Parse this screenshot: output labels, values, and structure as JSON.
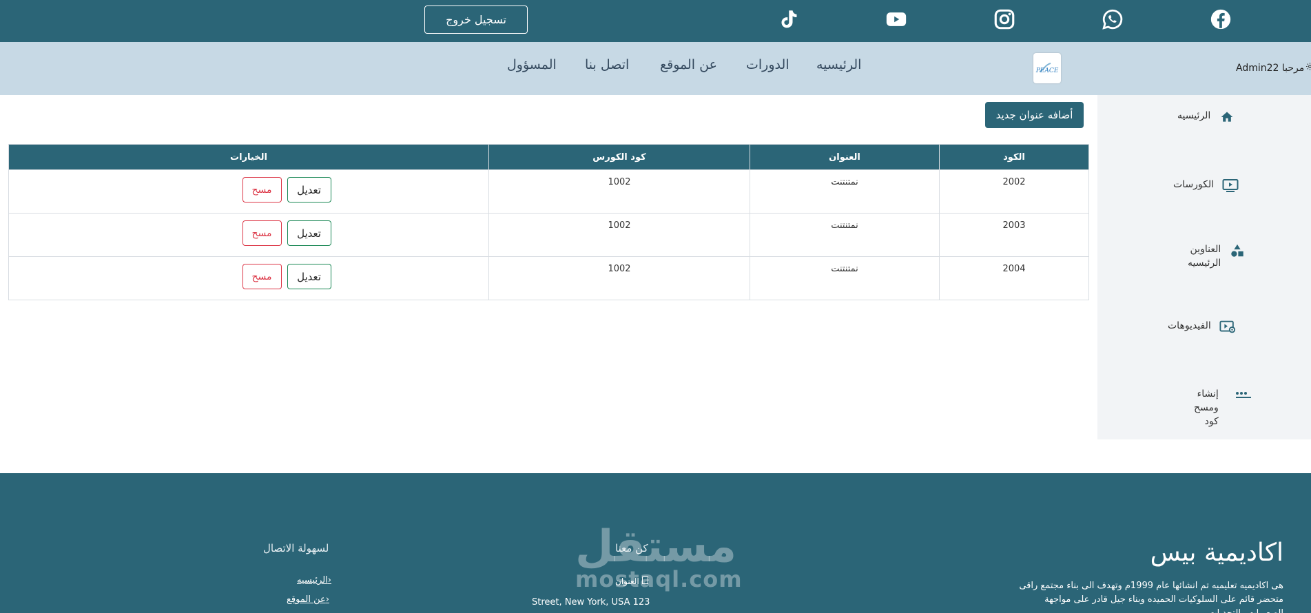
{
  "topbar": {
    "logout_label": "تسجيل خروج",
    "social_icons": [
      "tiktok-icon",
      "youtube-icon",
      "instagram-icon",
      "whatsapp-icon",
      "facebook-icon"
    ],
    "bg_color": "#2b6577"
  },
  "nav": {
    "links": [
      "الرئيسيه",
      "الدورات",
      "عن الموقع",
      "اتصل بنا",
      "المسؤول"
    ],
    "logo_text": "PEACE",
    "greeting": "مرحبا Admin22",
    "bg_color": "#c7d9e5"
  },
  "sidebar": {
    "items": [
      {
        "label": "الرئيسيه",
        "icon": "home-icon"
      },
      {
        "label": "الكورسات",
        "icon": "monitor-play-icon"
      },
      {
        "label": "العناوين\nالرئيسيه",
        "icon": "shapes-icon"
      },
      {
        "label": "الفيديوهات",
        "icon": "video-settings-icon"
      },
      {
        "label": "إنشاء\nومسح\nكود",
        "icon": "dots-icon"
      }
    ]
  },
  "main": {
    "add_button": "أضافه عنوان جديد",
    "table": {
      "headers": [
        "الكود",
        "العنوان",
        "كود الكورس",
        "الخيارات"
      ],
      "rows": [
        {
          "code": "2002",
          "title": "نمتنتنت",
          "course_code": "1002"
        },
        {
          "code": "2003",
          "title": "نمتنتنت",
          "course_code": "1002"
        },
        {
          "code": "2004",
          "title": "نمتنتنت",
          "course_code": "1002"
        }
      ],
      "edit_label": "تعديل",
      "delete_label": "مسح"
    }
  },
  "footer": {
    "title": "اكاديمية بيس",
    "description": "هى اكاديميه تعليميه تم انشائها عام 1999م وتهدف الى بناء مجتمع راقى متحضر قائم على السلوكيات الحميده وبناء جيل قادر على مواجهة الصعوبات والتحديات",
    "contact_title": "كن معنا",
    "contact_label": "العنوان",
    "contact_address": "Street, New York, USA 123",
    "links_title": "لسهولة الاتصال",
    "links": [
      "الرئيسيه",
      "عن الموقع"
    ]
  },
  "watermark": {
    "arabic": "مستقل",
    "latin": "mostaql.com"
  }
}
